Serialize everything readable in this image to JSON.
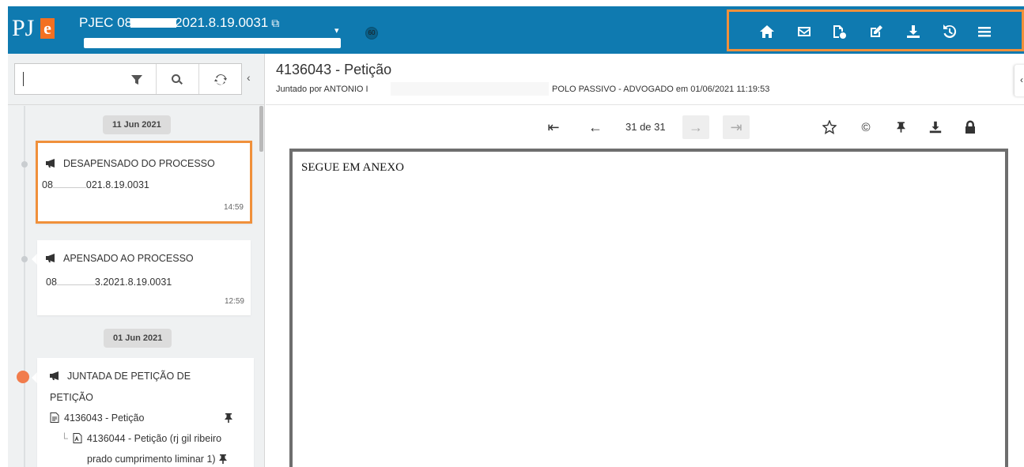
{
  "header": {
    "logo_text": "PJ",
    "logo_accent": "e",
    "process_title_prefix": "PJEC 08",
    "process_title_suffix": "2021.8.19.0031",
    "badge": "60",
    "toolbar_icons": [
      "home-icon",
      "envelope-icon",
      "document-add-icon",
      "edit-icon",
      "download-icon",
      "history-icon",
      "menu-icon"
    ]
  },
  "sidebar": {
    "search": {
      "value": ""
    },
    "dates": [
      "11 Jun 2021",
      "01 Jun 2021"
    ],
    "events": [
      {
        "title": "DESAPENSADO DO PROCESSO",
        "process_prefix": "08",
        "process_suffix": "021.8.19.0031",
        "time": "14:59"
      },
      {
        "title": "APENSADO AO PROCESSO",
        "process_prefix": "08",
        "process_suffix": "3.2021.8.19.0031",
        "time": "12:59"
      },
      {
        "title_line1": "JUNTADA DE PETIÇÃO DE",
        "title_line2": "PETIÇÃO",
        "doc1": "4136043 - Petição",
        "doc2_line1": "4136044 - Petição (rj gil ribeiro",
        "doc2_line2": "prado cumprimento liminar 1)"
      }
    ]
  },
  "document": {
    "title": "4136043 - Petição",
    "meta_prefix": "Juntado por ANTONIO I",
    "meta_suffix": "POLO PASSIVO - ADVOGADO em 01/06/2021 11:19:53",
    "page_indicator": "31 de 31",
    "content": "SEGUE EM ANEXO"
  },
  "colors": {
    "header_bg": "#0f7ab0",
    "highlight": "#f0903b",
    "logo_accent": "#f37021",
    "timeline_active": "#f17c4c"
  }
}
